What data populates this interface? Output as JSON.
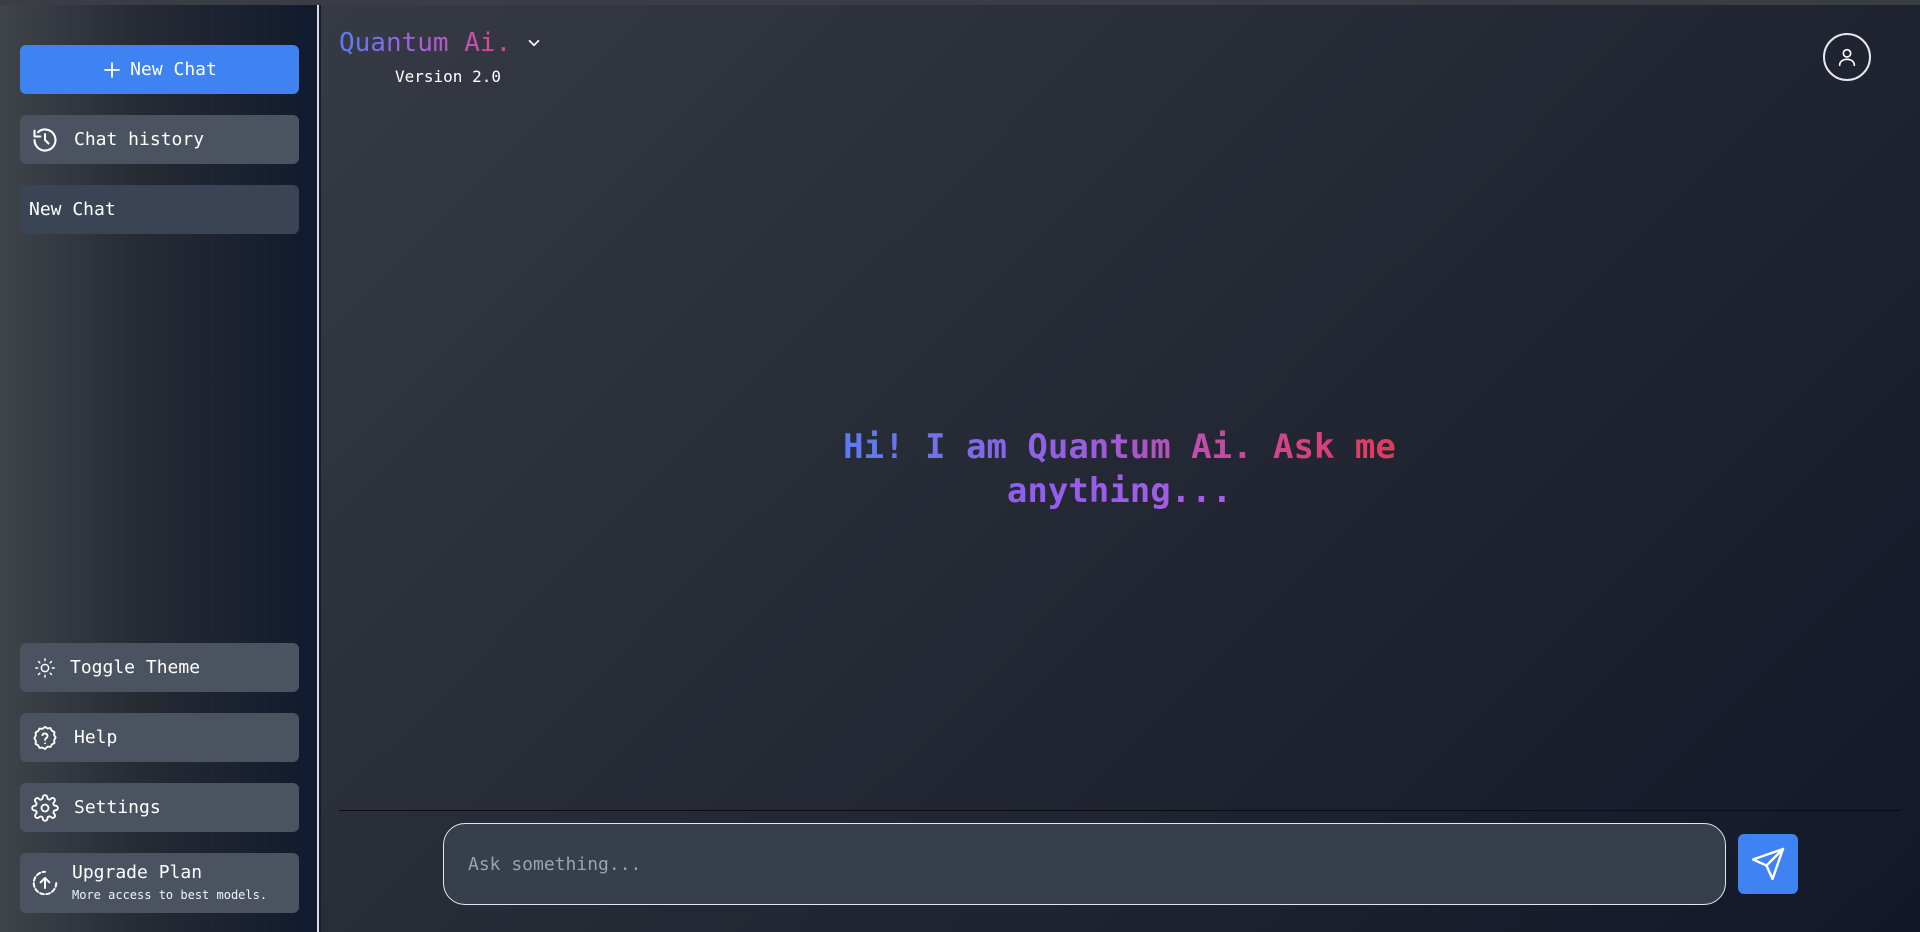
{
  "sidebar": {
    "new_chat_label": "New Chat",
    "chat_history_label": "Chat history",
    "recent_chats": [
      "New Chat"
    ],
    "toggle_theme_label": "Toggle Theme",
    "help_label": "Help",
    "settings_label": "Settings",
    "upgrade_title": "Upgrade Plan",
    "upgrade_subtitle": "More access to best models."
  },
  "header": {
    "brand": "Quantum Ai.",
    "version": "Version 2.0"
  },
  "main": {
    "greeting_line1": "Hi! I am Quantum Ai. Ask me",
    "greeting_line2": "anything..."
  },
  "composer": {
    "placeholder": "Ask something...",
    "value": ""
  },
  "colors": {
    "accent": "#3f82f2",
    "gradient_start": "#5b7cf0",
    "gradient_mid": "#b15bd8",
    "gradient_end": "#e43a5a"
  },
  "icons": {
    "new_chat": "plus-icon",
    "chat_history": "history-icon",
    "toggle_theme": "sun-icon",
    "help": "help-circle-icon",
    "settings": "gear-icon",
    "upgrade": "upload-circle-icon",
    "brand_dropdown": "chevron-down-icon",
    "avatar": "user-icon",
    "send": "send-icon"
  }
}
